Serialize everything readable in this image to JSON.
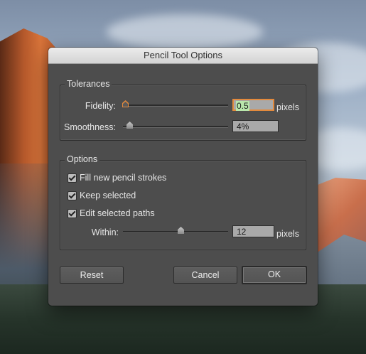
{
  "dialog": {
    "title": "Pencil Tool Options",
    "tolerances": {
      "group_label": "Tolerances",
      "fidelity": {
        "label": "Fidelity:",
        "value": "0.5",
        "unit": "pixels"
      },
      "smoothness": {
        "label": "Smoothness:",
        "value": "4%"
      }
    },
    "options": {
      "group_label": "Options",
      "fill_new": {
        "label": "Fill new pencil strokes",
        "checked": true
      },
      "keep_selected": {
        "label": "Keep selected",
        "checked": true
      },
      "edit_selected": {
        "label": "Edit selected paths",
        "checked": true
      },
      "within": {
        "label": "Within:",
        "value": "12",
        "unit": "pixels"
      }
    },
    "buttons": {
      "reset": "Reset",
      "cancel": "Cancel",
      "ok": "OK"
    }
  },
  "colors": {
    "dialog_bg": "#4d4d4d",
    "focus_ring": "#e38a3d",
    "selection": "#b9e7ac"
  }
}
